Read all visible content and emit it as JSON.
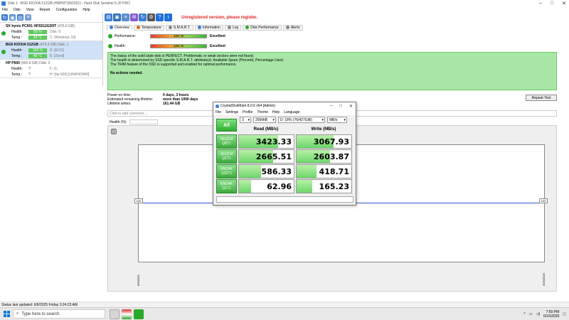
{
  "window": {
    "title": "Disk 1 : BG6 KIOXIA 512GB (HBPM7SN2021) - Hard Disk Sentinel 6.20 PRO",
    "controls": [
      "–",
      "□",
      "✕"
    ]
  },
  "menu": [
    "File",
    "Disk",
    "View",
    "Report",
    "Configuration",
    "Help"
  ],
  "unregistered": "Unregistered version, please register.",
  "disks": [
    {
      "name": "SK hynix PC601 HFS512GD9T",
      "size": "(476.9 GB)",
      "health": "95 %",
      "temp": "34 °C",
      "health_note": "Disk: 0",
      "temp_note": "C: [Windows 10]"
    },
    {
      "name": "BG6 KIOXIA 512GB",
      "size": "(476.9 GB)",
      "suffix": "Disk: 1",
      "health": "100 %",
      "temp": "46 °C",
      "health_note": "D: [EOS]",
      "temp_note": "E: [Zond]"
    },
    {
      "name": "HP P500",
      "size": "(465.8 GB)",
      "suffix": "Disk: 2",
      "health": "?",
      "temp": "?",
      "health_note": "F: G:",
      "temp_note": "H: [hp-500] [UNKNOWN]"
    }
  ],
  "labels": {
    "health": "Health:",
    "temp": "Temp.:",
    "performance": "Performance:"
  },
  "tabs": [
    {
      "label": "Overview",
      "color": "#3b7bd4"
    },
    {
      "label": "Temperature",
      "color": "#e06a2a"
    },
    {
      "label": "S.M.A.R.T.",
      "color": "#888888"
    },
    {
      "label": "Information",
      "color": "#3b7bd4"
    },
    {
      "label": "Log",
      "color": "#888888"
    },
    {
      "label": "Disk Performance",
      "color": "#2aa82a"
    },
    {
      "label": "Alerts",
      "color": "#888888"
    }
  ],
  "overview": {
    "performance_value": "100 %",
    "performance_fraction": 1.0,
    "performance_verdict": "Excellent",
    "health_value": "100 %",
    "health_fraction": 1.0,
    "health_verdict": "Excellent",
    "status_lines": [
      "The status of the solid state disk is PERFECT. Problematic or weak sectors were not found.",
      "The health is determined by SSD specific S.M.A.R.T. attribute(s): Available Spare (Percent), Percentage Used",
      "The TRIM feature of the SSD is supported and enabled for optimal performance."
    ],
    "no_actions": "No actions needed.",
    "power_on_label": "Power on time:",
    "power_on_value": "0 days, 3 hours",
    "lifetime_label": "Estimated remaining lifetime:",
    "lifetime_value": "more than 1000 days",
    "writes_label": "Lifetime writes:",
    "writes_value": "161.44 GB",
    "repeat_button": "Repeat Test",
    "comment_placeholder": "Click to add comment ...",
    "graph_title": "Health (%)",
    "graph_level_left": "100",
    "graph_level_right": "100",
    "date_left": "6/5/2025",
    "date_right": "6/15/2025"
  },
  "statusline": "Status last updated: 6/6/2025 Friday 3:24:23 AM",
  "cdm": {
    "title": "CrystalDiskMark 8.0.6 x64 [Admin]",
    "menu": [
      "File",
      "Settings",
      "Profile",
      "Theme",
      "Help",
      "Language"
    ],
    "count": "3",
    "size": "256MiB",
    "drive": "D: 18% (76/427GiB)",
    "unit": "MB/s",
    "all_label": "All",
    "read_head": "Read (MB/s)",
    "write_head": "Write (MB/s)",
    "tests": [
      {
        "l1": "SEQ1M",
        "l2": "Q8T1",
        "read": "3423.33",
        "write": "3067.93",
        "read_fill": 0.72,
        "write_fill": 0.68
      },
      {
        "l1": "SEQ1M",
        "l2": "Q1T1",
        "read": "2665.51",
        "write": "2603.87",
        "read_fill": 0.62,
        "write_fill": 0.61
      },
      {
        "l1": "RND4K",
        "l2": "Q32T1",
        "read": "586.33",
        "write": "418.71",
        "read_fill": 0.4,
        "write_fill": 0.36
      },
      {
        "l1": "RND4K",
        "l2": "Q1T1",
        "read": "62.96",
        "write": "165.23",
        "read_fill": 0.22,
        "write_fill": 0.28
      }
    ]
  },
  "taskbar": {
    "search_placeholder": "Type here to search",
    "time": "7:50 PM",
    "date": "6/15/2025"
  }
}
